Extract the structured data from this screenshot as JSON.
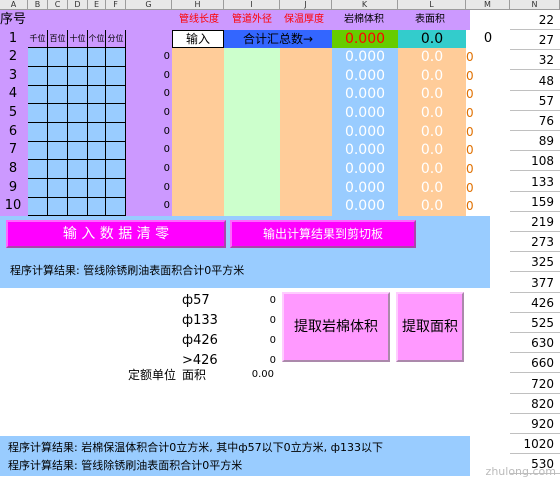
{
  "column_letters": [
    "A",
    "B",
    "C",
    "D",
    "E",
    "F",
    "G",
    "H",
    "I",
    "J",
    "K",
    "L",
    "M",
    "N"
  ],
  "header": {
    "xuhao": "序号",
    "digits": [
      "千位",
      "百位",
      "十位",
      "个位",
      "分位"
    ],
    "pipe_length": "管线长度",
    "pipe_diameter": "管道外径",
    "insulation": "保温厚度",
    "rock_wool": "岩棉体积",
    "surface_area": "表面积"
  },
  "row1": {
    "input_label": "输入",
    "total_label": "合计汇总数→",
    "rock_total": "0.000",
    "area_total": "0.0",
    "m_value": "0"
  },
  "rows": [
    {
      "n": "1",
      "g": "",
      "k": "",
      "l": "",
      "m": ""
    },
    {
      "n": "2",
      "g": "0",
      "k": "0.000",
      "l": "0.0",
      "m": "0"
    },
    {
      "n": "3",
      "g": "0",
      "k": "0.000",
      "l": "0.0",
      "m": "0"
    },
    {
      "n": "4",
      "g": "0",
      "k": "0.000",
      "l": "0.0",
      "m": "0"
    },
    {
      "n": "5",
      "g": "0",
      "k": "0.000",
      "l": "0.0",
      "m": "0"
    },
    {
      "n": "6",
      "g": "0",
      "k": "0.000",
      "l": "0.0",
      "m": "0"
    },
    {
      "n": "7",
      "g": "0",
      "k": "0.000",
      "l": "0.0",
      "m": "0"
    },
    {
      "n": "8",
      "g": "0",
      "k": "0.000",
      "l": "0.0",
      "m": "0"
    },
    {
      "n": "9",
      "g": "0",
      "k": "0.000",
      "l": "0.0",
      "m": "0"
    },
    {
      "n": "10",
      "g": "0",
      "k": "0.000",
      "l": "0.0",
      "m": "0"
    }
  ],
  "col_n": [
    "22",
    "27",
    "32",
    "48",
    "57",
    "76",
    "89",
    "108",
    "133",
    "159",
    "219",
    "273",
    "325",
    "377",
    "426",
    "525",
    "630",
    "660",
    "720",
    "820",
    "920",
    "1020",
    "530"
  ],
  "buttons": {
    "clear": "输 入 数 据 清 零",
    "copy": "输出计算结果到剪切板",
    "rock": "提取岩棉体积",
    "area": "提取面积"
  },
  "result_line_1": "程序计算结果: 管线除锈刷油表面积合计0平方米",
  "pipes": [
    {
      "label": "ф57",
      "value": "0"
    },
    {
      "label": "ф133",
      "value": "0"
    },
    {
      "label": "ф426",
      "value": "0"
    },
    {
      "label": ">426",
      "value": "0"
    }
  ],
  "quota_label": "定额单位",
  "area_label": "面积",
  "area_value": "0.00",
  "bottom_line_1": "程序计算结果: 岩棉保温体积合计0立方米, 其中ф57以下0立方米, ф133以下",
  "bottom_line_2": "程序计算结果: 管线除锈刷油表面积合计0平方米",
  "watermark": "zhulong.com"
}
